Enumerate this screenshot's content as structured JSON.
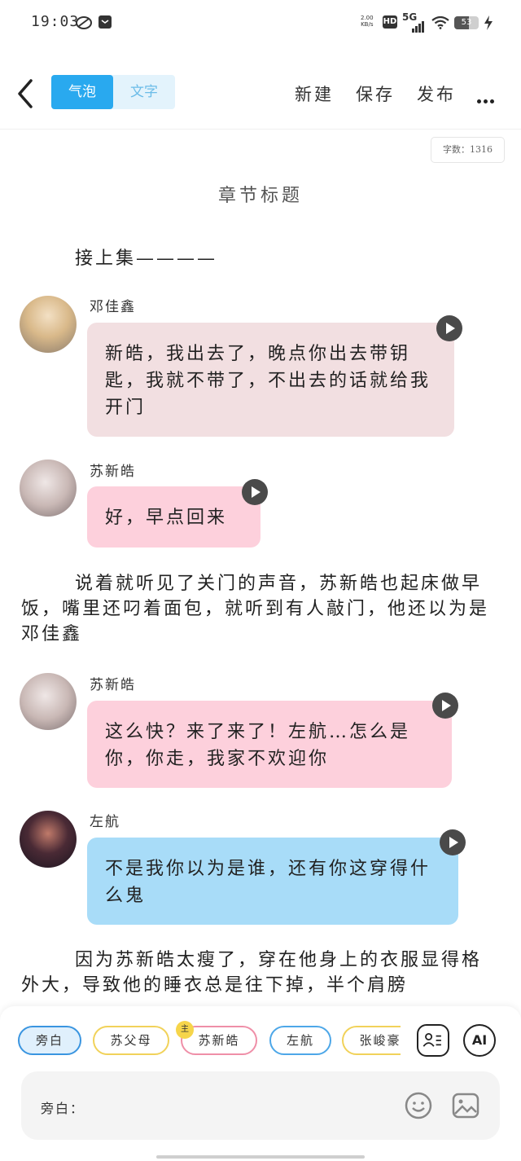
{
  "status": {
    "time": "19:03",
    "net_speed_value": "2.00",
    "net_speed_unit": "KB/s",
    "hd": "HD",
    "signal": "5G",
    "battery": "53"
  },
  "header": {
    "tab_bubble": "气泡",
    "tab_text": "文字",
    "new_label": "新建",
    "save_label": "保存",
    "publish_label": "发布"
  },
  "word_count": "字数：1316",
  "chapter_title": "章节标题",
  "intro": "接上集————",
  "messages": [
    {
      "name": "邓佳鑫",
      "text": "新皓，我出去了，晚点你出去带钥匙，我就不带了，不出去的话就给我开门",
      "color": "#f2dfe1"
    },
    {
      "name": "苏新皓",
      "text": "好，早点回来",
      "color": "#fdd0dc"
    },
    {
      "name": "苏新皓",
      "text": "这么快？来了来了！左航…怎么是你，你走，我家不欢迎你",
      "color": "#fdd0dc"
    },
    {
      "name": "左航",
      "text": "不是我你以为是谁，还有你这穿得什么鬼",
      "color": "#a8dcf8"
    }
  ],
  "narration1": "说着就听见了关门的声音，苏新皓也起床做早饭，嘴里还叼着面包，就听到有人敲门，他还以为是邓佳鑫",
  "narration2": "因为苏新皓太瘦了，穿在他身上的衣服显得格外大，导致他的睡衣总是往下掉，半个肩膀",
  "characters": [
    "旁白",
    "苏父母",
    "苏新皓",
    "左航",
    "张峻豪"
  ],
  "main_badge": "主",
  "ai_label": "AI",
  "input_label": "旁白："
}
